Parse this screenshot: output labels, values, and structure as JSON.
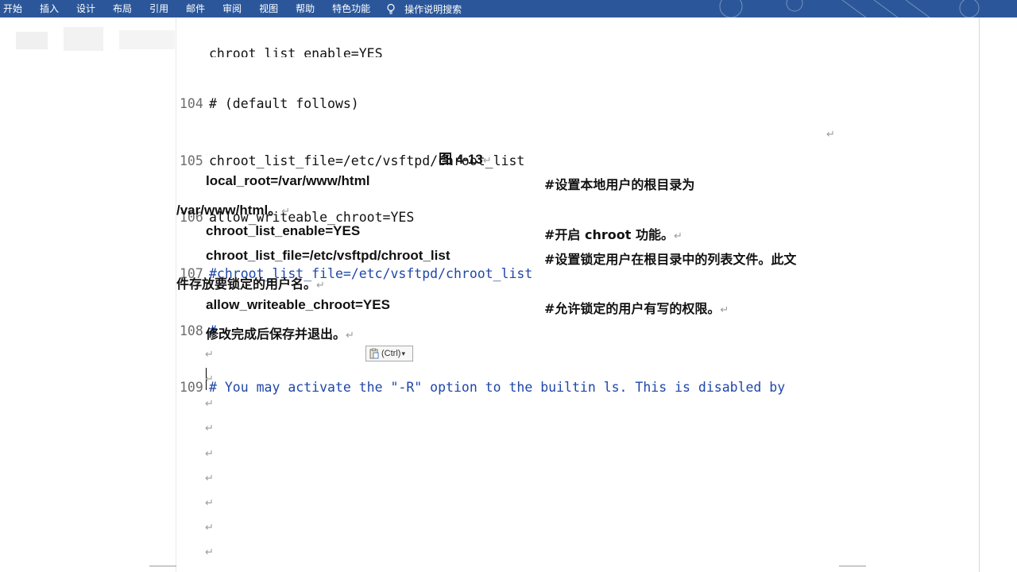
{
  "ribbon": {
    "tabs": [
      "开始",
      "插入",
      "设计",
      "布局",
      "引用",
      "邮件",
      "审阅",
      "视图",
      "帮助",
      "特色功能"
    ],
    "tell_me": "操作说明搜索",
    "accent": "#2b579a"
  },
  "code_block": [
    {
      "num": "",
      "text": "chroot_list_enable=YES",
      "color": "black"
    },
    {
      "num": "104",
      "text": "# (default follows)",
      "color": "black"
    },
    {
      "num": "105",
      "text": "chroot_list_file=/etc/vsftpd/chroot_list",
      "color": "black"
    },
    {
      "num": "106",
      "text": "allow_writeable_chroot=YES",
      "color": "black"
    },
    {
      "num": "107",
      "text": "#chroot_list_file=/etc/vsftpd/chroot_list",
      "color": "blue"
    },
    {
      "num": "108",
      "text": "#",
      "color": "blue"
    },
    {
      "num": "109",
      "text": "# You may activate the \"-R\" option to the builtin ls. This is disabled by",
      "color": "blue"
    }
  ],
  "paragraph_mark": "↵",
  "caption": "图 4-13",
  "doc": {
    "line1_code": "local_root=/var/www/html",
    "line1_comment": "#设置本地用户的根目录为",
    "line1_cont": "/var/www/html。",
    "line2_code": "chroot_list_enable=YES",
    "line2_comment": "#开启 chroot  功能。",
    "line3_code": "chroot_list_file=/etc/vsftpd/chroot_list",
    "line3_comment": "#设置锁定用户在根目录中的列表文件。此文",
    "line3_cont": "件存放要锁定的用户名。",
    "line4_code": "allow_writeable_chroot=YES",
    "line4_comment": "#允许锁定的用户有写的权限。",
    "line5": "修改完成后保存并退出。"
  },
  "paste_options": {
    "label": "(Ctrl)",
    "arrow": "▾"
  }
}
